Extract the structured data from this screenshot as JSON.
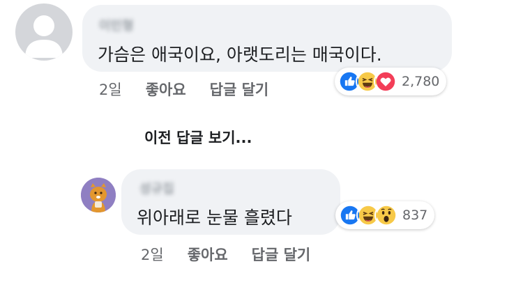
{
  "main_comment": {
    "author": "이민형",
    "text": "가슴은 애국이요, 아랫도리는 매국이다.",
    "reactions": {
      "icons": [
        "like-icon",
        "haha-icon",
        "love-icon"
      ],
      "count": "2,780"
    },
    "time": "2일",
    "like_label": "좋아요",
    "reply_label": "답글 달기"
  },
  "previous_replies_label": "이전 답글 보기...",
  "reply_comment": {
    "author": "성규집",
    "text": "위아래로 눈물 흘렸다",
    "reactions": {
      "icons": [
        "like-icon",
        "haha-icon",
        "wow-icon"
      ],
      "count": "837"
    },
    "time": "2일",
    "like_label": "좋아요",
    "reply_label": "답글 달기"
  },
  "colors": {
    "bubble": "#f0f2f5",
    "like_blue": "#1877f2",
    "love_red": "#f33e58",
    "haha_yellow": "#f7c948",
    "secondary_text": "#65676b"
  }
}
